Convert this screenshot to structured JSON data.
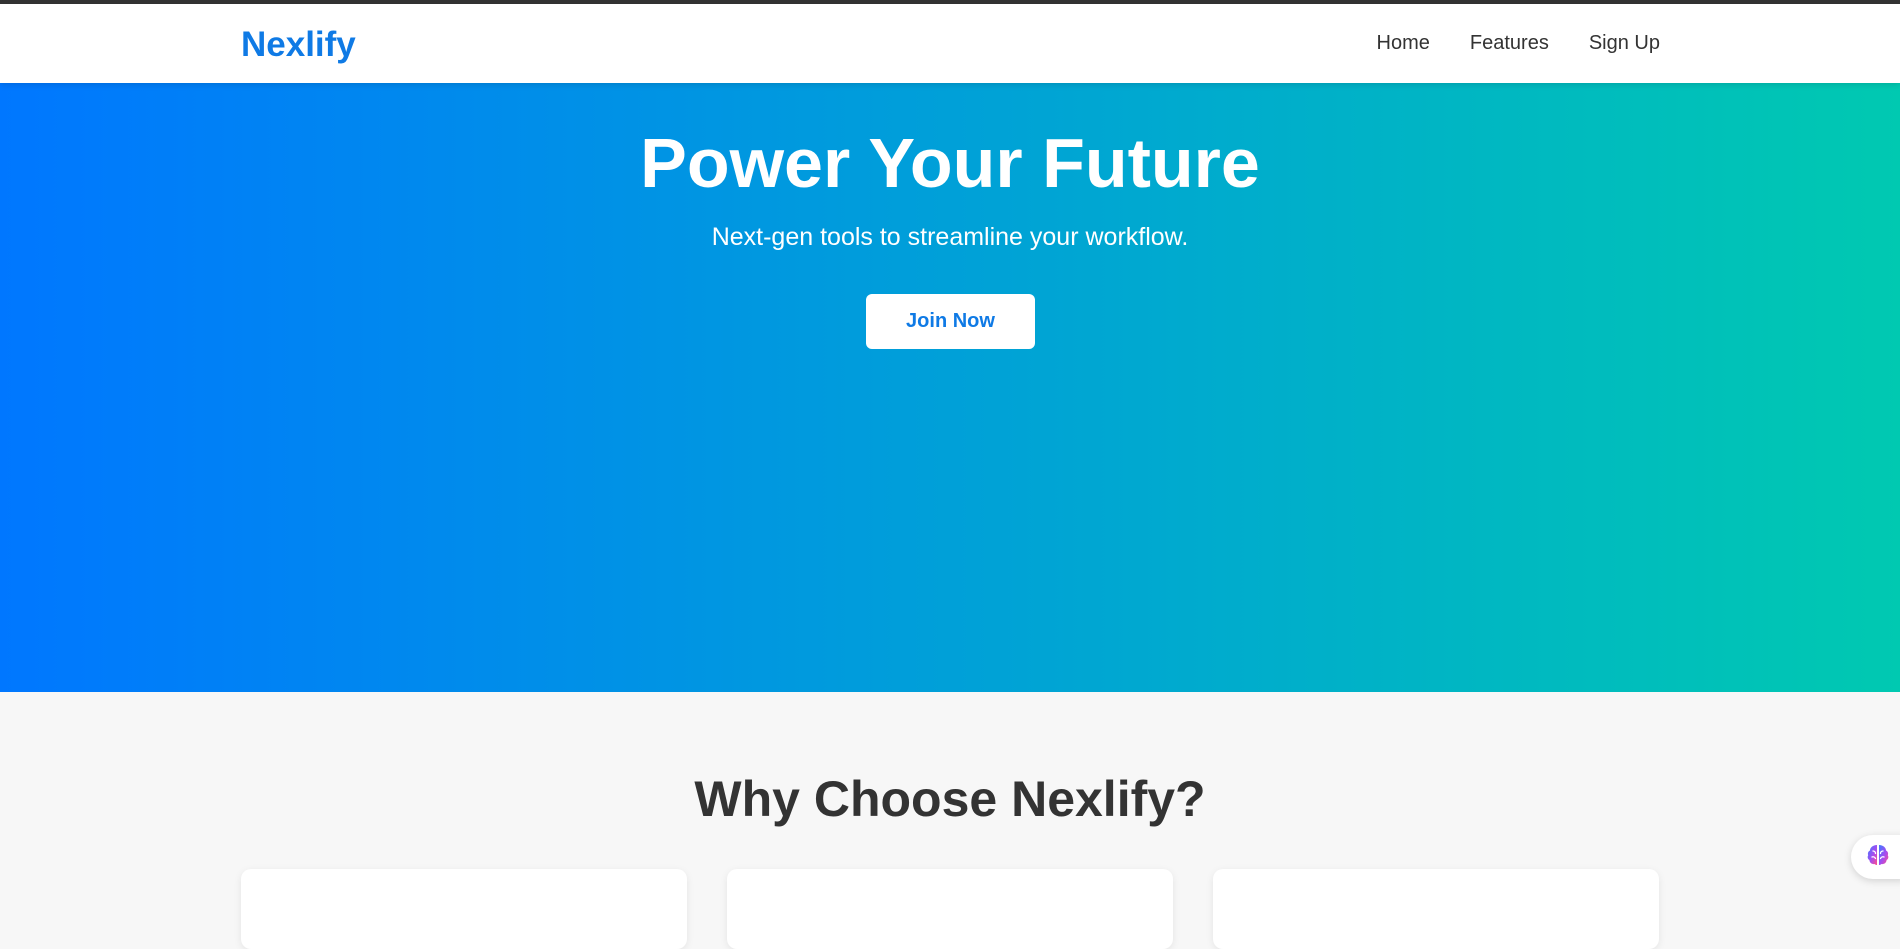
{
  "brand": {
    "name": "Nexlify",
    "color": "#0f7ae5"
  },
  "nav": {
    "items": [
      {
        "label": "Home"
      },
      {
        "label": "Features"
      },
      {
        "label": "Sign Up"
      }
    ]
  },
  "hero": {
    "title": "Power Your Future",
    "subtitle": "Next-gen tools to streamline your workflow.",
    "cta_label": "Join Now",
    "gradient_start": "#0077ff",
    "gradient_end": "#00c9b1"
  },
  "features": {
    "heading": "Why Choose Nexlify?"
  },
  "widget": {
    "icon": "brain-icon"
  }
}
